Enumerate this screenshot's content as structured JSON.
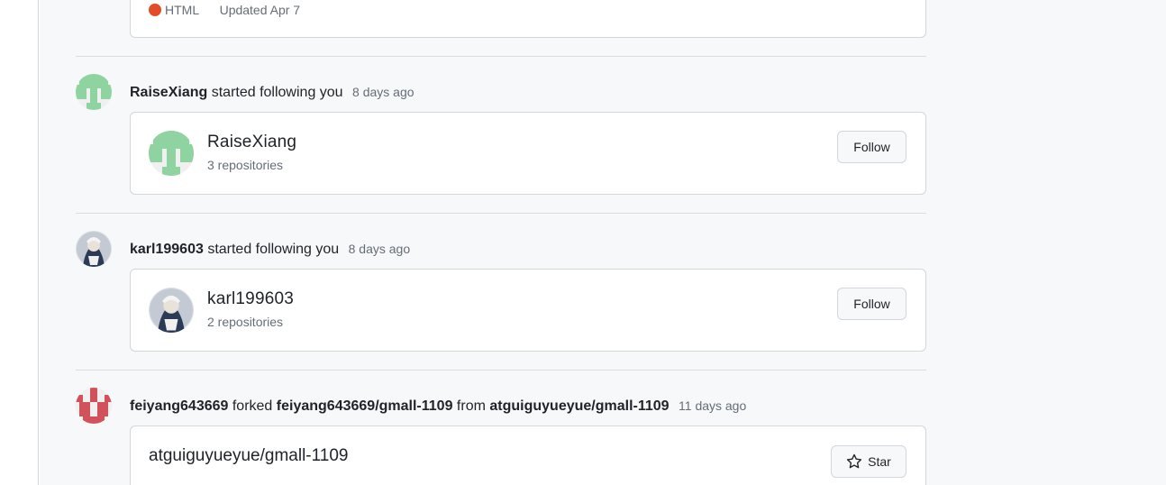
{
  "top_card": {
    "language": "HTML",
    "language_color": "#e34c26",
    "updated": "Updated Apr 7"
  },
  "events": [
    {
      "actor": "RaiseXiang",
      "verb": "started following you",
      "time": "8 days ago",
      "user_card": {
        "name": "RaiseXiang",
        "repos": "3 repositories",
        "button": "Follow"
      }
    },
    {
      "actor": "karl199603",
      "verb": "started following you",
      "time": "8 days ago",
      "user_card": {
        "name": "karl199603",
        "repos": "2 repositories",
        "button": "Follow"
      }
    },
    {
      "actor": "feiyang643669",
      "verb": "forked",
      "target": "feiyang643669/gmall-1109",
      "from_word": "from",
      "source": "atguiguyueyue/gmall-1109",
      "time": "11 days ago",
      "repo_card": {
        "title": "atguiguyueyue/gmall-1109",
        "button": "Star"
      }
    }
  ],
  "colors": {
    "identicon_green": "#8fd4a0",
    "identicon_red": "#d1525a",
    "page_bg": "#f6f8fa"
  }
}
